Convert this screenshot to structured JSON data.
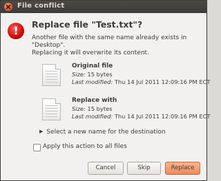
{
  "window": {
    "title": "File conflict"
  },
  "dialog": {
    "heading": "Replace file \"Test.txt\"?",
    "message_lines": [
      "Another file with the same name already exists in",
      "\"Desktop\".",
      "Replacing it will overwrite its content."
    ],
    "original": {
      "heading": "Original file",
      "size_label": "Size:",
      "size_value": "15 bytes",
      "modified_label": "Last modified:",
      "modified_value": "Thu 14 Jul 2011 12:09:16 PM ECT"
    },
    "replacement": {
      "heading": "Replace with",
      "size_label": "Size:",
      "size_value": "15 bytes",
      "modified_label": "Last modified:",
      "modified_value": "Thu 14 Jul 2011 12:09:16 PM ECT"
    },
    "expander_label": "Select a new name for the destination",
    "apply_all_label": "Apply this action to all files",
    "apply_all_checked": false
  },
  "buttons": {
    "cancel": "Cancel",
    "skip": "Skip",
    "replace": "Replace"
  },
  "colors": {
    "title_bar": "#3c3b37",
    "accent": "#ee8a5a",
    "error": "#cc0000"
  },
  "icons": {
    "close": "close-icon",
    "error": "error-icon",
    "file": "text-file-icon",
    "expander": "triangle-right-icon"
  }
}
